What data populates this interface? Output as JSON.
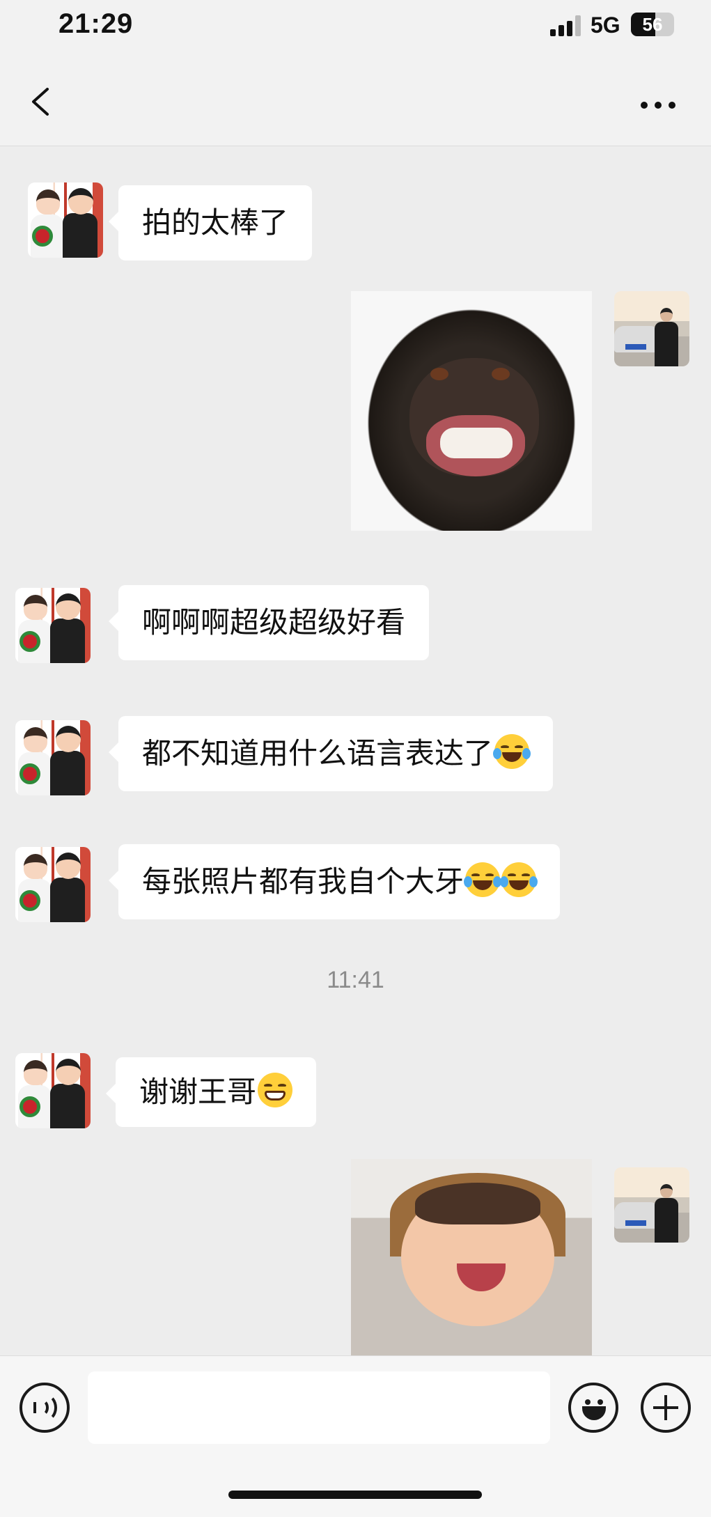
{
  "status_bar": {
    "time": "21:29",
    "network": "5G",
    "battery": "56",
    "battery_level": 0.56
  },
  "nav": {
    "back_icon": "chevron-left-icon",
    "more_icon": "ellipsis-icon"
  },
  "messages": [
    {
      "sender": "contact",
      "type": "text",
      "text": "拍的太棒了"
    },
    {
      "sender": "self",
      "type": "sticker",
      "sticker": "grinning-chimpanzee"
    },
    {
      "sender": "contact",
      "type": "text",
      "text": "啊啊啊超级超级好看"
    },
    {
      "sender": "contact",
      "type": "text",
      "text": "都不知道用什么语言表达了",
      "emoji": [
        "face-with-tears-of-joy"
      ]
    },
    {
      "sender": "contact",
      "type": "text",
      "text": "每张照片都有我自个大牙",
      "emoji": [
        "face-with-tears-of-joy",
        "face-with-tears-of-joy"
      ]
    },
    {
      "sender": "contact",
      "type": "text",
      "text": "谢谢王哥",
      "emoji": [
        "grinning-face"
      ]
    },
    {
      "sender": "self",
      "type": "sticker",
      "sticker": "laughing-child"
    }
  ],
  "timestamp": "11:41",
  "input_bar": {
    "voice_icon": "voice-icon",
    "input_value": "",
    "emoji_icon": "emoji-icon",
    "plus_icon": "plus-icon"
  }
}
